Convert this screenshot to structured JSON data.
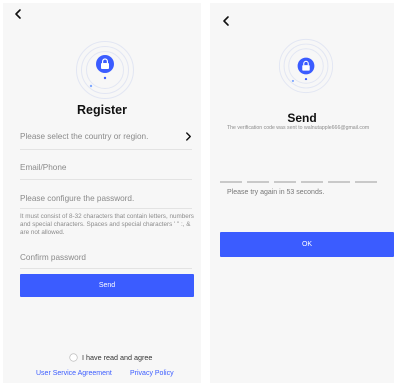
{
  "register": {
    "title": "Register",
    "country_placeholder": "Please select the country or region.",
    "email_placeholder": "Email/Phone",
    "password_placeholder": "Please configure the password.",
    "password_hint": "It must consist of 8-32 characters that contain letters, numbers and special characters. Spaces and special characters ' \" :, & are not allowed.",
    "confirm_placeholder": "Confirm password",
    "send_label": "Send",
    "agree_label": "I have read and agree",
    "user_agreement": "User Service Agreement",
    "privacy_policy": "Privacy Policy"
  },
  "verify": {
    "title": "Send",
    "sent_message": "The verification code was sent to walnutapple666@gmail.com",
    "countdown": "Please try again in 53 seconds.",
    "ok_label": "OK"
  },
  "colors": {
    "accent": "#3b5cff",
    "background": "#f7f7f7"
  },
  "icons": [
    "back-arrow-icon",
    "lock-icon",
    "chevron-right-icon",
    "checkbox-circle-icon"
  ]
}
